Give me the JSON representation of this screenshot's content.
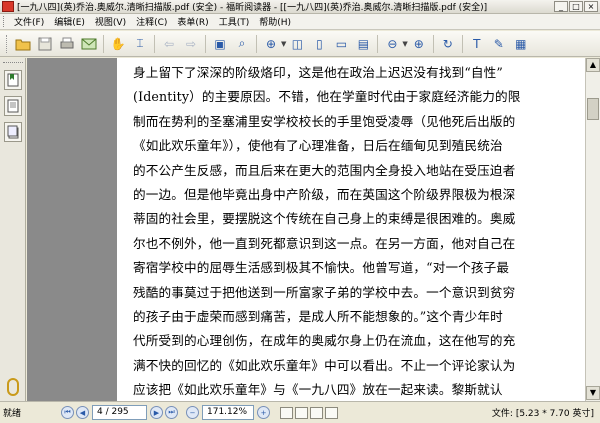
{
  "window": {
    "title": "[一九八四](英)乔治.奥威尔.清晰扫描版.pdf (安全) - 福昕阅读器 - [[一九八四](英)乔治.奥威尔.清晰扫描版.pdf (安全)]",
    "minimize": "_",
    "maximize": "□",
    "close": "×"
  },
  "menu": [
    "文件(F)",
    "编辑(E)",
    "视图(V)",
    "注释(C)",
    "表单(R)",
    "工具(T)",
    "帮助(H)"
  ],
  "toolbar": {
    "icons": [
      "open-icon",
      "save-icon",
      "print-icon",
      "email-icon",
      "hand-icon",
      "select-icon",
      "back-icon",
      "forward-icon",
      "snapshot-icon",
      "find-icon",
      "zoom-in-icon",
      "zoom-tool-icon",
      "actual-size-icon",
      "fit-page-icon",
      "fit-width-icon",
      "zoom-out-icon",
      "zoom-plus-icon",
      "rotate-icon",
      "typewriter-icon",
      "note-icon",
      "pdf-icon"
    ]
  },
  "document": {
    "lines": [
      "身上留下了深深的阶级烙印，这是他在政治上迟迟没有找到“自性”",
      "(Identity）的主要原因。不错，他在学童时代由于家庭经济能力的限",
      "制而在势利的圣塞浦里安学校校长的手里饱受凌辱（见他死后出版的",
      "《如此欢乐童年》），使他有了心理准备，日后在缅甸见到殖民统治",
      "的不公产生反感，而且后来在更大的范围内全身投入地站在受压迫者",
      "的一边。但是他毕竟出身中产阶级，而在英国这个阶级界限极为根深",
      "蒂固的社会里，要摆脱这个传统在自己身上的束缚是很困难的。奥威",
      "尔也不例外，他一直到死都意识到这一点。在另一方面，他对自己在",
      "寄宿学校中的屈辱生活感到极其不愉快。他曾写道，“对一个孩子最",
      "残酷的事莫过于把他送到一所富家子弟的学校中去。一个意识到贫穷",
      "的孩子由于虚荣而感到痛苦，是成人所不能想象的。”这个青少年时",
      "代所受到的心理创伤，在成年的奥威尔身上仍在流血，这在他写的充",
      "满不快的回忆的《如此欢乐童年》中可以看出。不止一个评论家认为",
      "应该把《如此欢乐童年》与《一九八四》放在一起来读。黎斯就认"
    ]
  },
  "status": {
    "ready": "就绪",
    "page": "4 / 295",
    "zoom": "171.12%",
    "file_info": "文件: [5.23 * 7.70 英寸]"
  }
}
